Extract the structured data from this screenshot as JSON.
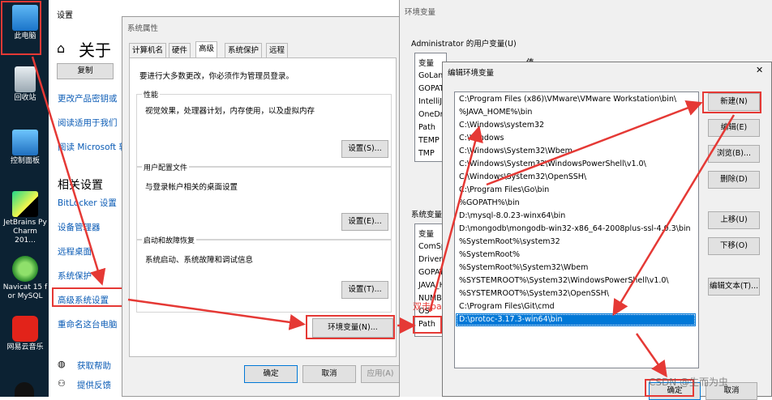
{
  "desktop": {
    "icons": [
      {
        "label": "此电脑",
        "icon": "computer-icon"
      },
      {
        "label": "回收站",
        "icon": "recycle-bin-icon"
      },
      {
        "label": "控制面板",
        "icon": "control-panel-icon"
      },
      {
        "label": "JetBrains Py Charm 201...",
        "icon": "pycharm-icon"
      },
      {
        "label": "Navicat 15 f or MySQL",
        "icon": "navicat-icon"
      },
      {
        "label": "网易云音乐",
        "icon": "netease-music-icon"
      }
    ]
  },
  "settings": {
    "title": "设置",
    "about_title": "关于",
    "copy_button": "复制",
    "links": [
      "更改产品密钥或",
      "阅读适用于我们",
      "阅读 Microsoft 软"
    ],
    "related_heading": "相关设置",
    "related_links": [
      "BitLocker 设置",
      "设备管理器",
      "远程桌面",
      "系统保护",
      "高级系统设置",
      "重命名这台电脑"
    ],
    "help": "获取帮助",
    "feedback": "提供反馈"
  },
  "sysprops": {
    "title": "系统属性",
    "tabs": [
      "计算机名",
      "硬件",
      "高级",
      "系统保护",
      "远程"
    ],
    "notice": "要进行大多数更改，你必须作为管理员登录。",
    "performance": {
      "title": "性能",
      "desc": "视觉效果，处理器计划，内存使用，以及虚拟内存",
      "button": "设置(S)..."
    },
    "profile": {
      "title": "用户配置文件",
      "desc": "与登录帐户相关的桌面设置",
      "button": "设置(E)..."
    },
    "startup": {
      "title": "启动和故障恢复",
      "desc": "系统启动、系统故障和调试信息",
      "button": "设置(T)..."
    },
    "env_button": "环境变量(N)...",
    "ok": "确定",
    "cancel": "取消",
    "apply": "应用(A)"
  },
  "envwin": {
    "title": "环境变量",
    "user_group": "Administrator 的用户变量(U)",
    "user_col": "变量",
    "user_col_value": "值",
    "user_vars": [
      "GoLan",
      "GOPAT",
      "IntelliJ",
      "OneDr",
      "Path",
      "TEMP",
      "TMP"
    ],
    "sys_group": "系统变量",
    "sys_col": "变量",
    "sys_vars": [
      "ComSp",
      "Driver",
      "GOPAT",
      "JAVA_H",
      "NUMB",
      "OS",
      "Path"
    ]
  },
  "editdlg": {
    "title": "编辑环境变量",
    "close": "✕",
    "paths": [
      "C:\\Program Files (x86)\\VMware\\VMware Workstation\\bin\\",
      "%JAVA_HOME%\\bin",
      "C:\\Windows\\system32",
      "C:\\Windows",
      "C:\\Windows\\System32\\Wbem",
      "C:\\Windows\\System32\\WindowsPowerShell\\v1.0\\",
      "C:\\Windows\\System32\\OpenSSH\\",
      "C:\\Program Files\\Go\\bin",
      "%GOPATH%\\bin",
      "D:\\mysql-8.0.23-winx64\\bin",
      "D:\\mongodb\\mongodb-win32-x86_64-2008plus-ssl-4.0.3\\bin",
      "%SystemRoot%\\system32",
      "%SystemRoot%",
      "%SystemRoot%\\System32\\Wbem",
      "%SYSTEMROOT%\\System32\\WindowsPowerShell\\v1.0\\",
      "%SYSTEMROOT%\\System32\\OpenSSH\\",
      "C:\\Program Files\\Git\\cmd",
      "D:\\protoc-3.17.3-win64\\bin"
    ],
    "selected_index": 17,
    "buttons": [
      "新建(N)",
      "编辑(E)",
      "浏览(B)...",
      "删除(D)",
      "上移(U)",
      "下移(O)",
      "编辑文本(T)..."
    ],
    "ok": "确定",
    "cancel": "取消"
  },
  "annotation": {
    "text": "双击path",
    "color": "#e53935"
  },
  "watermark": "CSDN @生而为虫"
}
